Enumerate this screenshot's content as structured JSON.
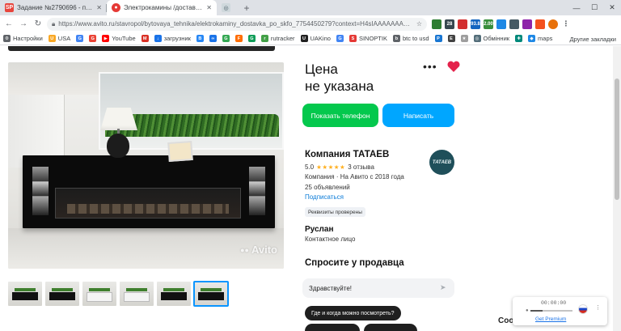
{
  "browser": {
    "tabs": [
      {
        "favicon": "SP",
        "title": "Задание №2790696 - просмотр з"
      },
      {
        "favicon": "●",
        "title": "Электрокамины /доставка по ск"
      },
      {
        "favicon": "◎",
        "title": ""
      }
    ],
    "new_tab": "+",
    "url": "https://www.avito.ru/stavropol/bytovaya_tehnika/elektrokaminy_dostavka_po_skfo_7754450279?context=H4sIAAAAAAAA_wE_A...",
    "extensions": [
      {
        "label": "",
        "color": "#2e7d32"
      },
      {
        "label": "28",
        "color": "#37474f"
      },
      {
        "label": "",
        "color": "#d32f2f"
      },
      {
        "label": "93.8",
        "color": "#1565c0"
      },
      {
        "label": "2.00",
        "color": "#388e3c"
      },
      {
        "label": "",
        "color": "#1e88e5"
      },
      {
        "label": "",
        "color": "#455a64"
      },
      {
        "label": "",
        "color": "#8e24aa"
      },
      {
        "label": "",
        "color": "#f4511e"
      }
    ],
    "bookmarks": [
      {
        "icon": "⚙",
        "label": "Настройки",
        "color": "#5f6368"
      },
      {
        "icon": "U",
        "label": "USA",
        "color": "#f9a825"
      },
      {
        "icon": "G",
        "label": "",
        "color": "#4285f4"
      },
      {
        "icon": "G",
        "label": "",
        "color": "#ea4335"
      },
      {
        "icon": "▶",
        "label": "YouTube",
        "color": "#ff0000"
      },
      {
        "icon": "M",
        "label": "",
        "color": "#d93025"
      },
      {
        "icon": "↓",
        "label": "загрузник",
        "color": "#1a73e8"
      },
      {
        "icon": "B",
        "label": "",
        "color": "#2787f5"
      },
      {
        "icon": "∞",
        "label": "",
        "color": "#1a73e8"
      },
      {
        "icon": "G",
        "label": "",
        "color": "#34a853"
      },
      {
        "icon": "F",
        "label": "",
        "color": "#ff6d00"
      },
      {
        "icon": "G",
        "label": "",
        "color": "#0f9d58"
      },
      {
        "icon": "r",
        "label": "rutracker",
        "color": "#43a047"
      },
      {
        "icon": "U",
        "label": "UAKino",
        "color": "#212121"
      },
      {
        "icon": "G",
        "label": "",
        "color": "#4285f4"
      },
      {
        "icon": "S",
        "label": "SINOPTIK",
        "color": "#e53935"
      },
      {
        "icon": "b",
        "label": "btc to usd",
        "color": "#5f6368"
      },
      {
        "icon": "P",
        "label": "",
        "color": "#1976d2"
      },
      {
        "icon": "E",
        "label": "",
        "color": "#424242"
      },
      {
        "icon": "★",
        "label": "",
        "color": "#9e9e9e"
      },
      {
        "icon": "◎",
        "label": "Обмінник",
        "color": "#546e7a"
      },
      {
        "icon": "✚",
        "label": "",
        "color": "#00897b"
      },
      {
        "icon": "◆",
        "label": "maps",
        "color": "#1e88e5"
      }
    ],
    "other_bookmarks": "Другие закладки"
  },
  "listing": {
    "price_label": "Цена\nне указана",
    "show_phone": "Показать телефон",
    "write": "Написать",
    "seller": {
      "name": "Компания ТАТАЕВ",
      "logo_text": "ТАТАЕВ",
      "rating": "5.0",
      "stars": "★★★★★",
      "reviews": "3 отзыва",
      "since": "Компания · На Авито с 2018 года",
      "ads": "25 объявлений",
      "subscribe": "Подписаться",
      "verified": "Реквизиты проверены"
    },
    "contact": {
      "name": "Руслан",
      "role": "Контактное лицо"
    },
    "ask": {
      "title": "Спросите у продавца",
      "input_value": "Здравствуйте!",
      "chips": [
        "Где и когда можно посмотреть?",
        "",
        ""
      ]
    },
    "watermark": "Avito",
    "thumbnails": 6,
    "active_thumbnail": 6
  },
  "widget": {
    "time": "00:00:00",
    "premium": "Get Premium",
    "progress": 0.28
  },
  "cut_off_text": "Coo"
}
